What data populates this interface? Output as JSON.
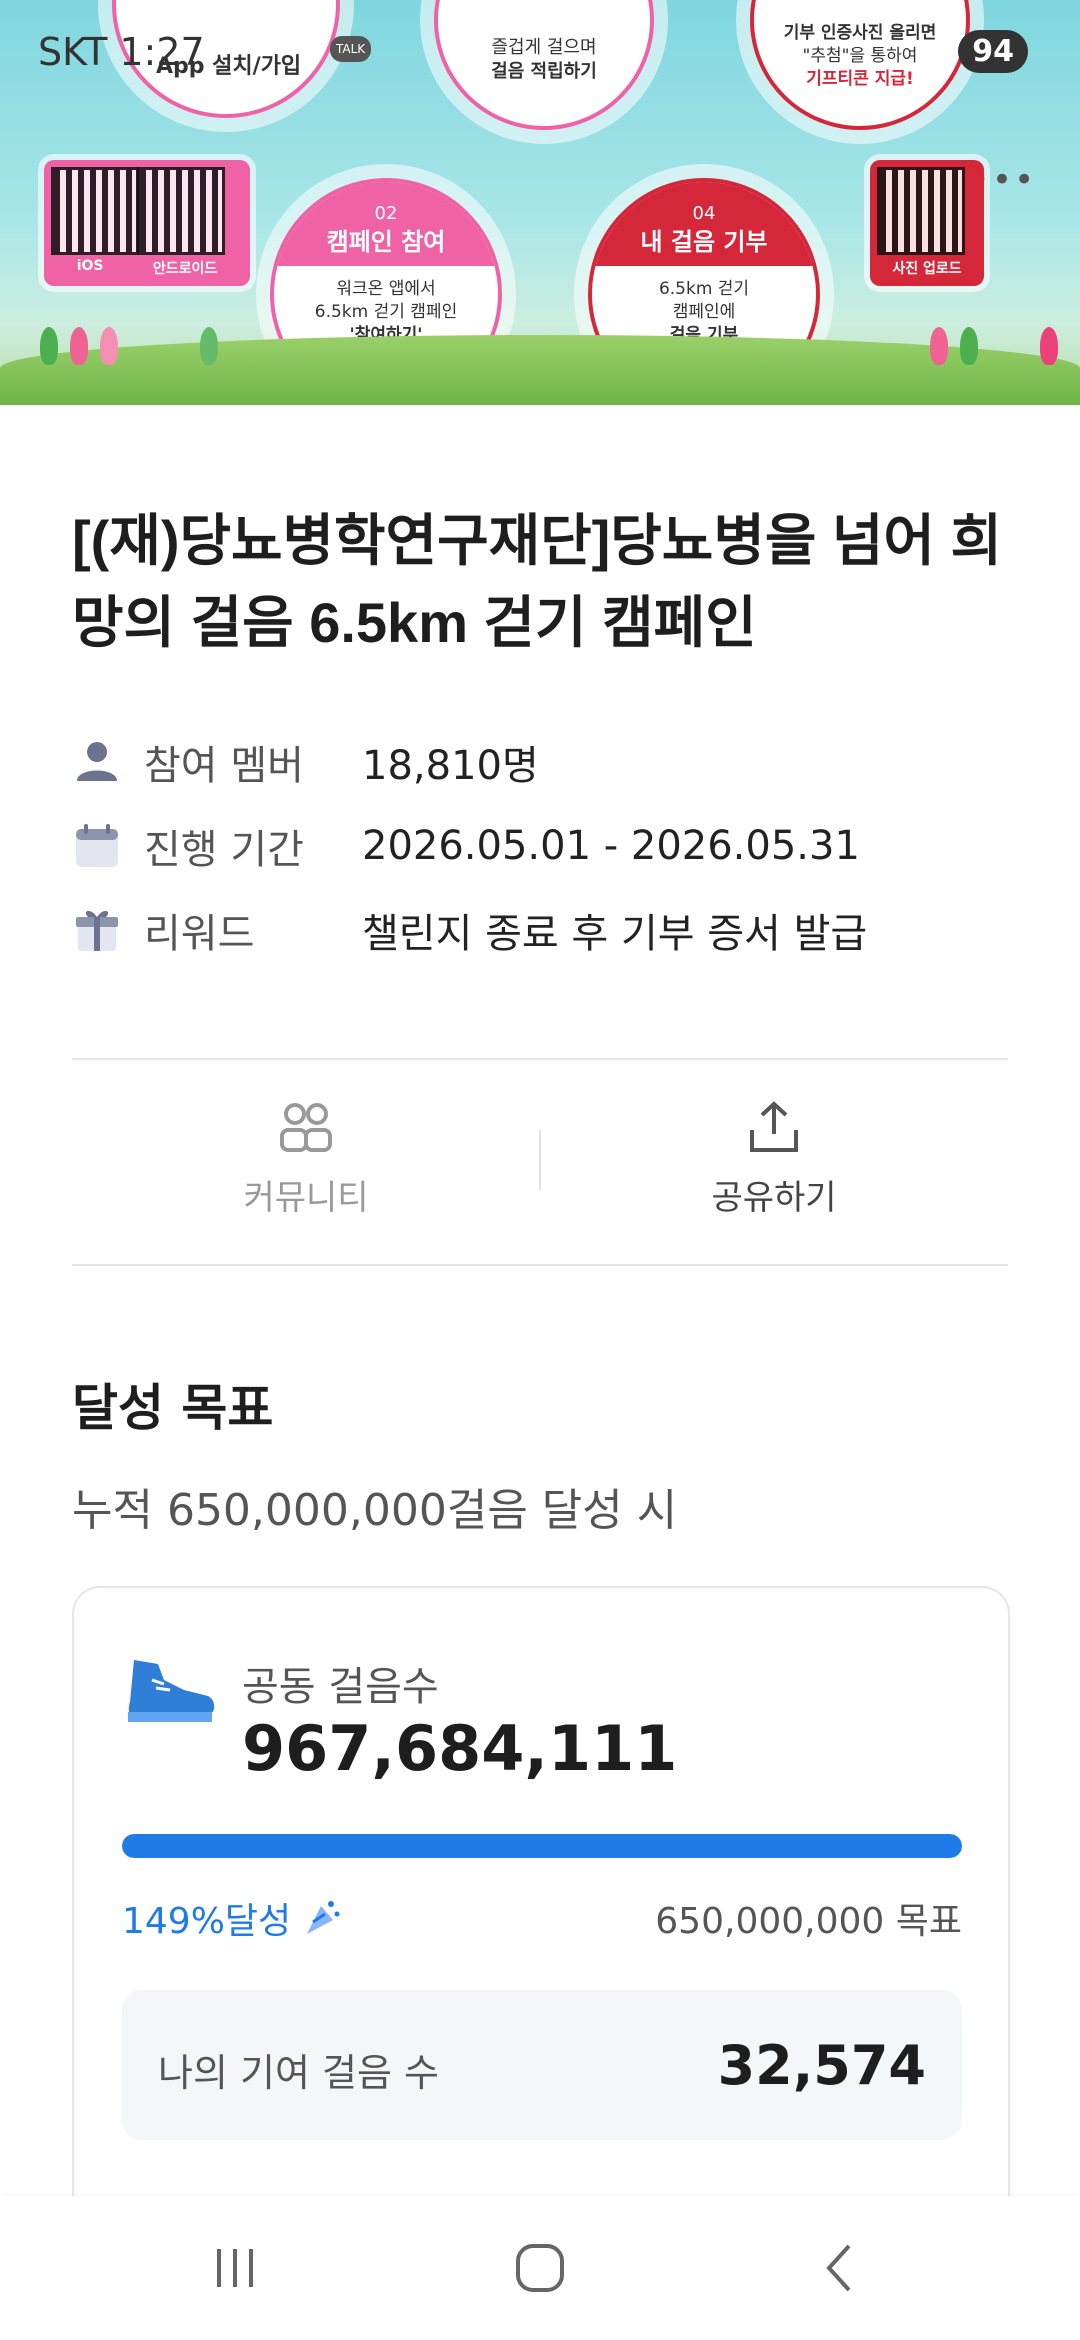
{
  "status_bar": {
    "carrier_time": "SKT 1:27",
    "battery": "94"
  },
  "banner": {
    "app_install": "App 설치/가입",
    "talk": "TALK",
    "step_top_center": "즐겁게 걸으며",
    "step_top_center_bold": "걸음 적립하기",
    "step_top_right": "기부 인증사진 올리면",
    "step_top_right_2": "\"추첨\"을 통하여",
    "step_top_right_bold": "기프티콘 지급!",
    "qr_ios": "iOS",
    "qr_android": "안드로이드",
    "qr_photo": "사진 업로드",
    "step02_num": "02",
    "step02_title": "캠페인 참여",
    "step02_line1": "워크온 앱에서",
    "step02_line2": "6.5km 걷기 캠페인",
    "step02_bold": "'참여하기'",
    "step04_num": "04",
    "step04_title": "내 걸음 기부",
    "step04_line1": "6.5km 걷기",
    "step04_line2": "캠페인에",
    "step04_bold": "걸음 기부"
  },
  "campaign": {
    "title": "[(재)당뇨병학연구재단]당뇨병을 넘어 희망의 걸음 6.5km 걷기 캠페인"
  },
  "info": [
    {
      "icon": "person-icon",
      "label": "참여 멤버",
      "value": "18,810명"
    },
    {
      "icon": "calendar-icon",
      "label": "진행 기간",
      "value": "2026.05.01 - 2026.05.31"
    },
    {
      "icon": "gift-icon",
      "label": "리워드",
      "value": "챌린지 종료 후 기부 증서 발급"
    }
  ],
  "actions": {
    "community": "커뮤니티",
    "share": "공유하기"
  },
  "goal": {
    "section_title": "달성 목표",
    "condition": "누적 650,000,000걸음 달성 시",
    "steps_label": "공동 걸음수",
    "steps_total": "967,684,111",
    "progress_fraction": 1.0,
    "achieved_text": "149%달성",
    "target_text": "650,000,000 목표",
    "my_label": "나의 기여 걸음 수",
    "my_value": "32,574"
  },
  "colors": {
    "accent": "#1e7be8",
    "pink": "#ef62a6",
    "red": "#d4283a"
  }
}
